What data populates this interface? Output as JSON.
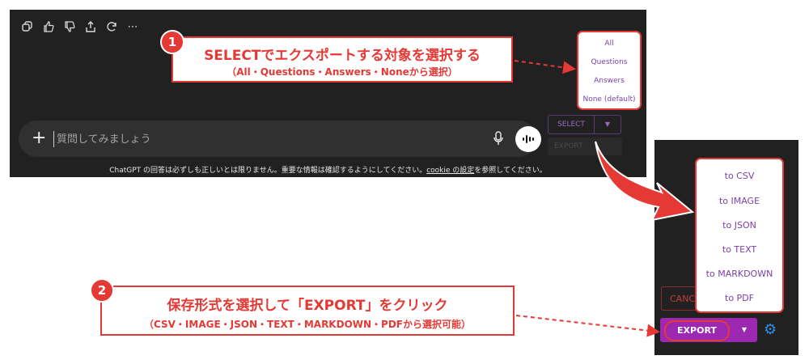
{
  "chat": {
    "input_placeholder": "質問してみましょう",
    "disclaimer_prefix": "ChatGPT の回答は必ずしも正しいとは限りません。重要な情報は確認するようにしてください。",
    "disclaimer_link": "cookie の設定",
    "disclaimer_suffix": "を参照してください。",
    "select_label": "SELECT",
    "export_label_ghost": "EXPORT"
  },
  "select_menu": {
    "items": [
      "All",
      "Questions",
      "Answers",
      "None (default)"
    ]
  },
  "callout_1": {
    "number": "1",
    "title": "SELECTでエクスポートする対象を選択する",
    "subtitle": "（All・Questions・Answers・Noneから選択）"
  },
  "export_panel": {
    "cancel_label": "CANC",
    "export_label": "EXPORT"
  },
  "export_menu": {
    "items": [
      "to CSV",
      "to IMAGE",
      "to JSON",
      "to TEXT",
      "to MARKDOWN",
      "to PDF"
    ]
  },
  "callout_2": {
    "number": "2",
    "title": "保存形式を選択して「EXPORT」をクリック",
    "subtitle": "（CSV・IMAGE・JSON・TEXT・MARKDOWN・PDFから選択可能）"
  },
  "colors": {
    "accent_red": "#e53935",
    "accent_purple": "#9c27b0",
    "menu_text": "#7b3fa8",
    "dark_bg": "#212121"
  }
}
